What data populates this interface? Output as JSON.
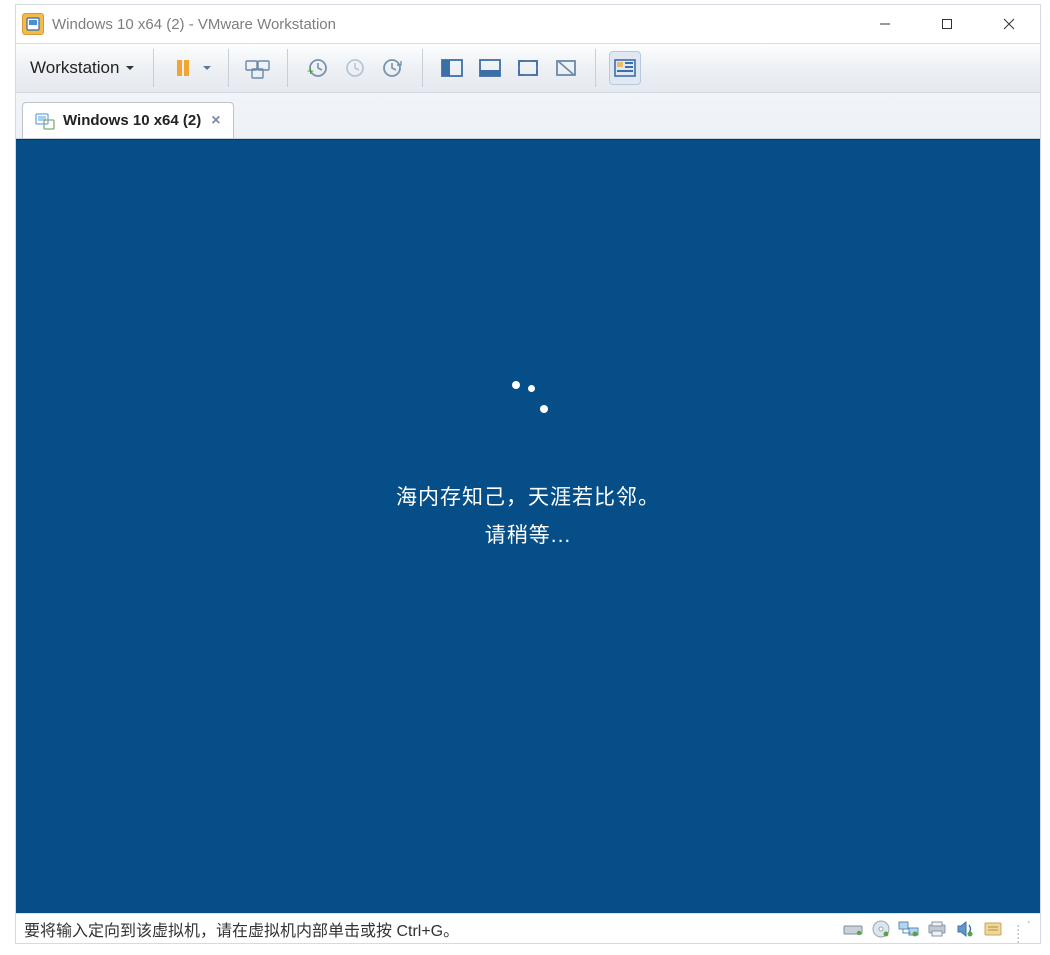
{
  "window": {
    "title": "Windows 10 x64 (2) - VMware Workstation"
  },
  "toolbar": {
    "menu_label": "Workstation"
  },
  "tabs": {
    "active": {
      "label": "Windows 10 x64 (2)"
    }
  },
  "vm_screen": {
    "line1": "海内存知己，天涯若比邻。",
    "line2": "请稍等..."
  },
  "statusbar": {
    "message": "要将输入定向到该虚拟机，请在虚拟机内部单击或按 Ctrl+G。"
  },
  "colors": {
    "vm_bg": "#054e87",
    "vm_text": "#ffffff"
  }
}
